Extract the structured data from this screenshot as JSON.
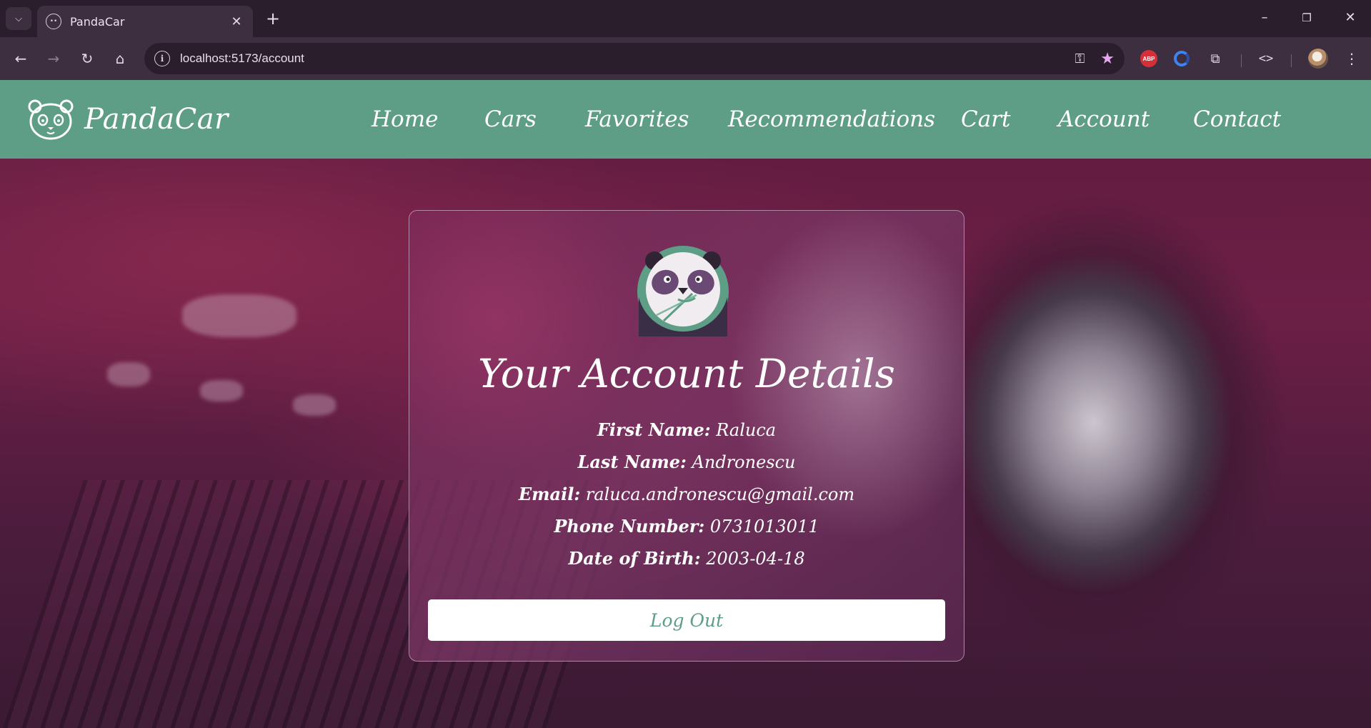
{
  "browser": {
    "tab_title": "PandaCar",
    "url": "localhost:5173/account",
    "extensions": [
      "adblock-plus-icon",
      "grammarly-icon",
      "extensions-icon",
      "devtools-icon",
      "profile-avatar"
    ]
  },
  "site": {
    "brand": "PandaCar",
    "nav": [
      "Home",
      "Cars",
      "Favorites",
      "Recommendations",
      "Cart",
      "Account",
      "Contact"
    ],
    "accent_color": "#5e9e86"
  },
  "account": {
    "title": "Your Account Details",
    "fields": [
      {
        "label": "First Name:",
        "value": "Raluca"
      },
      {
        "label": "Last Name:",
        "value": "Andronescu"
      },
      {
        "label": "Email:",
        "value": "raluca.andronescu@gmail.com"
      },
      {
        "label": "Phone Number:",
        "value": "0731013011"
      },
      {
        "label": "Date of Birth:",
        "value": "2003-04-18"
      }
    ],
    "logout_label": "Log Out"
  }
}
